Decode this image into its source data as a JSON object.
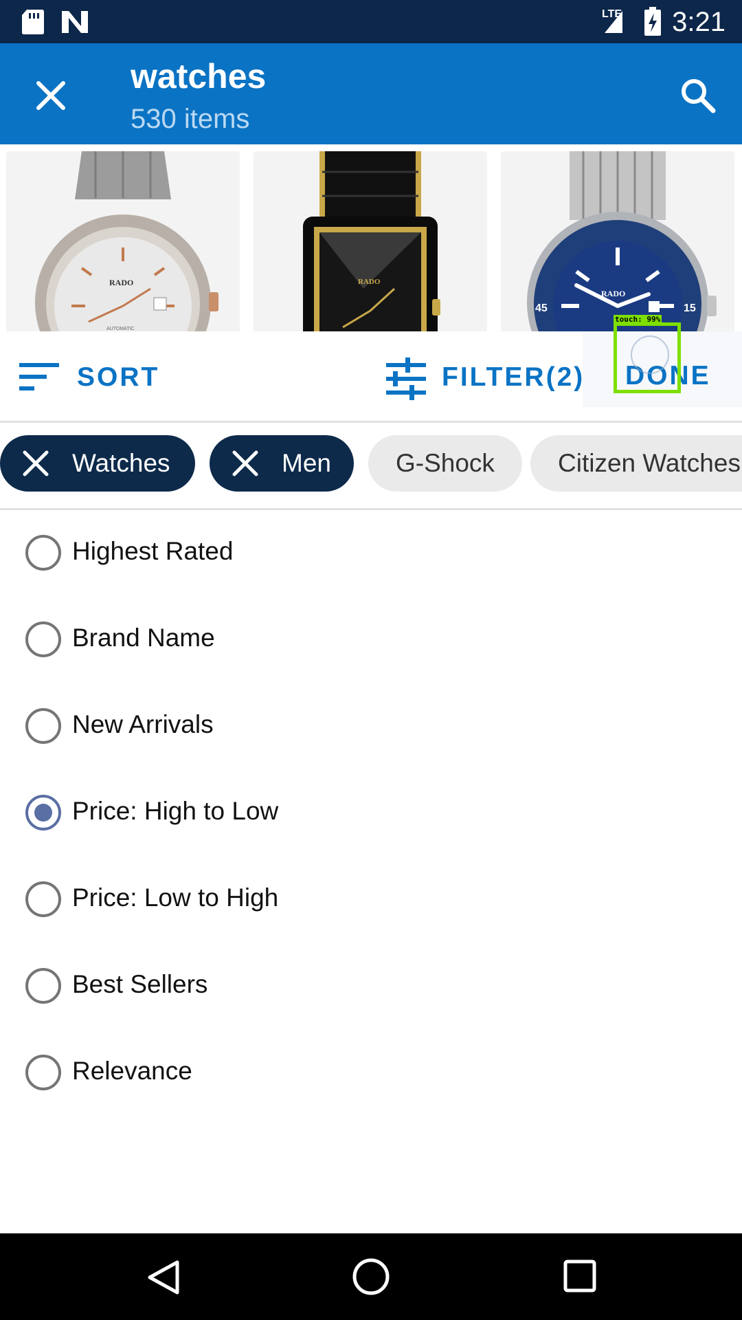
{
  "status_bar": {
    "time": "3:21",
    "network": "LTE"
  },
  "app_bar": {
    "title": "watches",
    "subtitle": "530 items"
  },
  "products": [
    {
      "brand": "RADO",
      "dial_text": "AUTOMATIC"
    },
    {
      "brand": "RADO"
    },
    {
      "brand": "RADO",
      "bezel_left": "45",
      "bezel_right": "15"
    }
  ],
  "toolbar": {
    "sort_label": "SORT",
    "filter_label": "FILTER(2)",
    "done_label": "DONE"
  },
  "touch_overlay": {
    "label": "touch: 99%"
  },
  "chips": [
    {
      "label": "Watches",
      "active": true
    },
    {
      "label": "Men",
      "active": true
    },
    {
      "label": "G-Shock",
      "active": false
    },
    {
      "label": "Citizen Watches",
      "active": false
    }
  ],
  "sort_options": [
    {
      "label": "Highest Rated",
      "selected": false
    },
    {
      "label": "Brand Name",
      "selected": false
    },
    {
      "label": "New Arrivals",
      "selected": false
    },
    {
      "label": "Price: High to Low",
      "selected": true
    },
    {
      "label": "Price: Low to High",
      "selected": false
    },
    {
      "label": "Best Sellers",
      "selected": false
    },
    {
      "label": "Relevance",
      "selected": false
    }
  ],
  "colors": {
    "app_bar": "#0a73c4",
    "status_bar": "#0c2749",
    "accent": "#0a73c4",
    "chip_active": "#0d2a4a",
    "radio_checked": "#5a6fa3"
  }
}
